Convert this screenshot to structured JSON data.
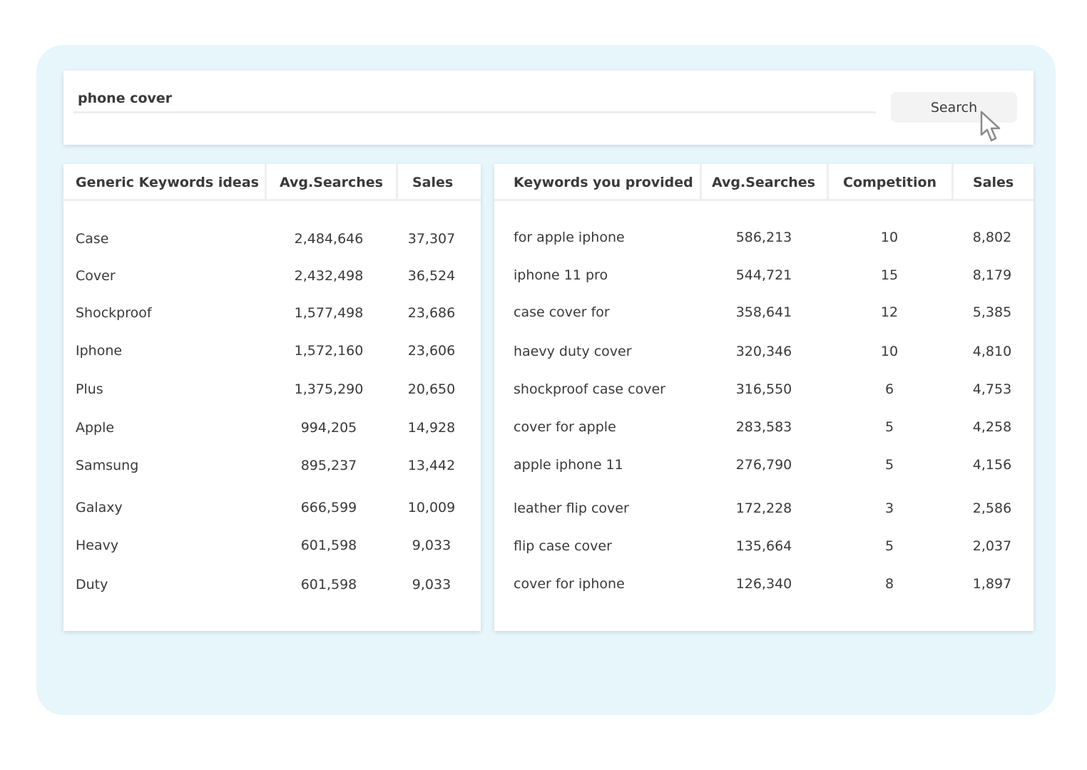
{
  "search": {
    "query": "phone cover",
    "button_label": "Search",
    "cursor_icon": "pointer-arrow-icon"
  },
  "generic_table": {
    "headers": [
      "Generic Keywords ideas",
      "Avg.Searches",
      "Sales"
    ],
    "rows": [
      {
        "keyword": "Case",
        "avg_searches": "2,484,646",
        "sales": "37,307"
      },
      {
        "keyword": "Cover",
        "avg_searches": "2,432,498",
        "sales": "36,524"
      },
      {
        "keyword": "Shockproof",
        "avg_searches": "1,577,498",
        "sales": "23,686"
      },
      {
        "keyword": "Iphone",
        "avg_searches": "1,572,160",
        "sales": "23,606"
      },
      {
        "keyword": "Plus",
        "avg_searches": "1,375,290",
        "sales": "20,650"
      },
      {
        "keyword": "Apple",
        "avg_searches": "994,205",
        "sales": "14,928"
      },
      {
        "keyword": "Samsung",
        "avg_searches": "895,237",
        "sales": "13,442"
      },
      {
        "keyword": "Galaxy",
        "avg_searches": "666,599",
        "sales": "10,009"
      },
      {
        "keyword": "Heavy",
        "avg_searches": "601,598",
        "sales": "9,033"
      },
      {
        "keyword": "Duty",
        "avg_searches": "601,598",
        "sales": "9,033"
      }
    ]
  },
  "provided_table": {
    "headers": [
      "Keywords you provided",
      "Avg.Searches",
      "Competition",
      "Sales"
    ],
    "rows": [
      {
        "keyword": "for apple iphone",
        "avg_searches": "586,213",
        "competition": "10",
        "sales": "8,802"
      },
      {
        "keyword": "iphone 11 pro",
        "avg_searches": "544,721",
        "competition": "15",
        "sales": "8,179"
      },
      {
        "keyword": "case cover for",
        "avg_searches": "358,641",
        "competition": "12",
        "sales": "5,385"
      },
      {
        "keyword": "haevy duty cover",
        "avg_searches": "320,346",
        "competition": "10",
        "sales": "4,810"
      },
      {
        "keyword": "shockproof case cover",
        "avg_searches": "316,550",
        "competition": "6",
        "sales": "4,753"
      },
      {
        "keyword": "cover for apple",
        "avg_searches": "283,583",
        "competition": "5",
        "sales": "4,258"
      },
      {
        "keyword": "apple iphone 11",
        "avg_searches": "276,790",
        "competition": "5",
        "sales": "4,156"
      },
      {
        "keyword": "leather flip cover",
        "avg_searches": "172,228",
        "competition": "3",
        "sales": "2,586"
      },
      {
        "keyword": "flip case cover",
        "avg_searches": "135,664",
        "competition": "5",
        "sales": "2,037"
      },
      {
        "keyword": "cover for iphone",
        "avg_searches": "126,340",
        "competition": "8",
        "sales": "1,897"
      }
    ]
  }
}
